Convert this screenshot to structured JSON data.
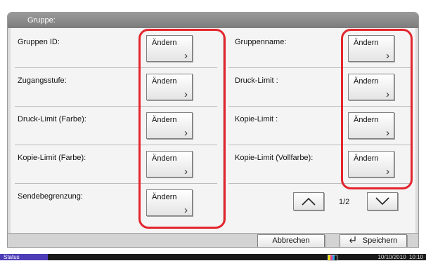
{
  "window": {
    "title": "Gruppe:"
  },
  "rows_left": [
    {
      "label": "Gruppen ID:",
      "button": "Ändern"
    },
    {
      "label": "Zugangsstufe:",
      "button": "Ändern"
    },
    {
      "label": "Druck-Limit (Farbe):",
      "button": "Ändern"
    },
    {
      "label": "Kopie-Limit (Farbe):",
      "button": "Ändern"
    },
    {
      "label": "Sendebegrenzung:",
      "button": "Ändern"
    }
  ],
  "rows_right": [
    {
      "label": "Gruppenname:",
      "button": "Ändern"
    },
    {
      "label": "Druck-Limit :",
      "button": "Ändern"
    },
    {
      "label": "Kopie-Limit :",
      "button": "Ändern"
    },
    {
      "label": "Kopie-Limit (Vollfarbe):",
      "button": "Ändern"
    }
  ],
  "pagination": {
    "indicator": "1/2",
    "up_icon": "chevron-up-icon",
    "down_icon": "chevron-down-icon"
  },
  "footer": {
    "cancel_label": "Abbrechen",
    "save_label": "Speichern",
    "save_icon": "return-arrow-icon"
  },
  "statusbar": {
    "status_label": "Status",
    "datetime": "10/10/2010  10:10",
    "toner_icon": "toner-level-icon"
  },
  "colors": {
    "highlight": "#e4252d",
    "status_button": "#4d3cb8",
    "titlebar": "#8a8a8a"
  }
}
